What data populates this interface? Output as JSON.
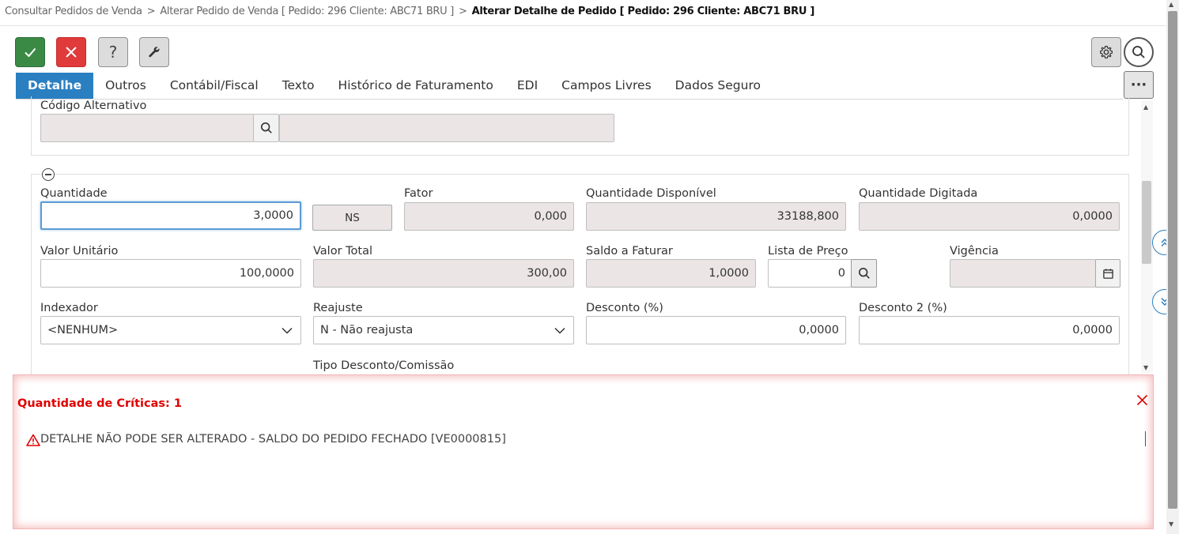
{
  "breadcrumb": {
    "item1": "Consultar Pedidos de Venda",
    "sep": ">",
    "item2": "Alterar Pedido de Venda [ Pedido: 296 Cliente: ABC71 BRU ]",
    "current": "Alterar Detalhe de Pedido [ Pedido: 296 Cliente: ABC71 BRU ]"
  },
  "toolbar": {
    "confirm_icon": "check-icon",
    "cancel_icon": "close-icon",
    "help_label": "?",
    "tools_icon": "wrench-icon",
    "settings_icon": "gear-icon",
    "search_icon": "search-icon"
  },
  "tabs": [
    {
      "label": "Detalhe"
    },
    {
      "label": "Outros"
    },
    {
      "label": "Contábil/Fiscal"
    },
    {
      "label": "Texto"
    },
    {
      "label": "Histórico de Faturamento"
    },
    {
      "label": "EDI"
    },
    {
      "label": "Campos Livres"
    },
    {
      "label": "Dados Seguro"
    }
  ],
  "more_label": "···",
  "form": {
    "codigo_alternativo": {
      "label": "Código Alternativo",
      "code": "",
      "desc": ""
    },
    "quantidade": {
      "label": "Quantidade",
      "value": "3,0000"
    },
    "unidade": {
      "value": "NS"
    },
    "fator": {
      "label": "Fator",
      "value": "0,000"
    },
    "qtd_disponivel": {
      "label": "Quantidade Disponível",
      "value": "33188,800"
    },
    "qtd_digitada": {
      "label": "Quantidade Digitada",
      "value": "0,0000"
    },
    "valor_unitario": {
      "label": "Valor Unitário",
      "value": "100,0000"
    },
    "valor_total": {
      "label": "Valor Total",
      "value": "300,00"
    },
    "saldo_faturar": {
      "label": "Saldo a Faturar",
      "value": "1,0000"
    },
    "lista_preco": {
      "label": "Lista de Preço",
      "value": "0"
    },
    "vigencia": {
      "label": "Vigência",
      "value": ""
    },
    "indexador": {
      "label": "Indexador",
      "value": "<NENHUM>"
    },
    "reajuste": {
      "label": "Reajuste",
      "value": "N - Não reajusta"
    },
    "desconto": {
      "label": "Desconto (%)",
      "value": "0,0000"
    },
    "desconto2": {
      "label": "Desconto 2 (%)",
      "value": "0,0000"
    },
    "tipo_desconto": {
      "label": "Tipo Desconto/Comissão"
    }
  },
  "errors": {
    "title": "Quantidade de Críticas: 1",
    "message": "DETALHE NÃO PODE SER ALTERADO - SALDO DO PEDIDO FECHADO [VE0000815]"
  },
  "colors": {
    "accent": "#2a7fc1",
    "confirm": "#3a8a46",
    "cancel": "#e03a3a",
    "error": "#e00000"
  }
}
